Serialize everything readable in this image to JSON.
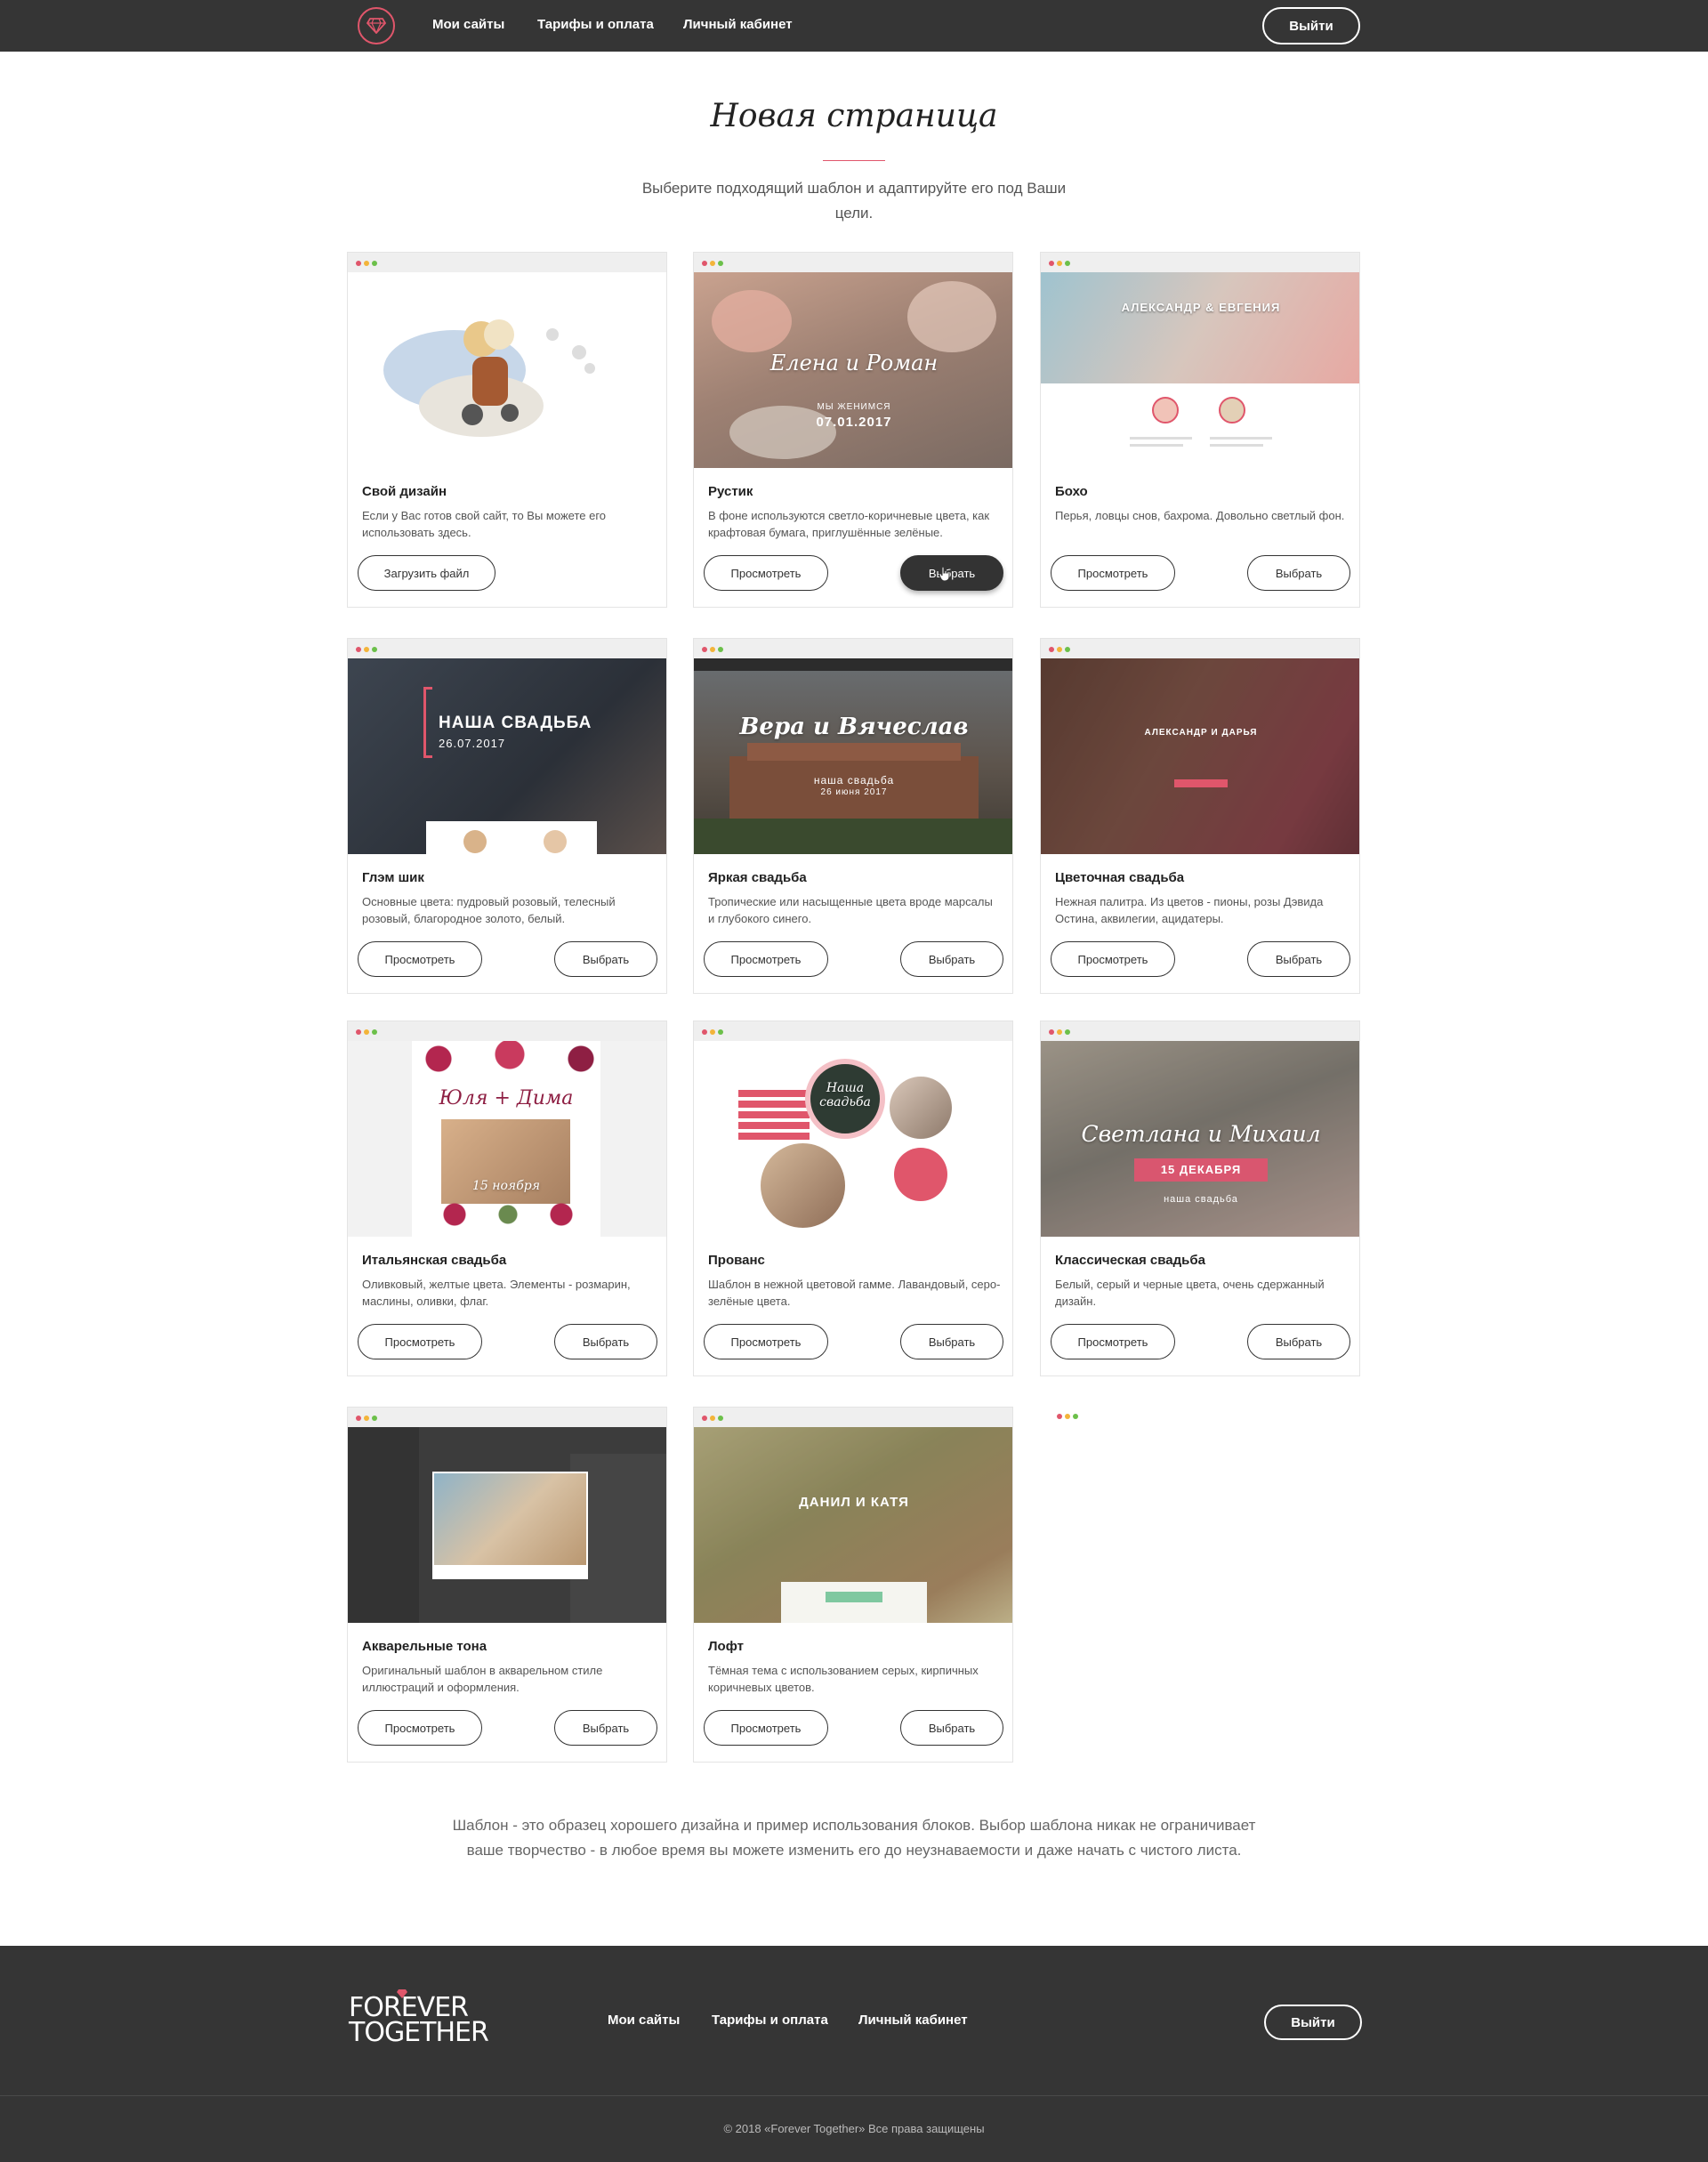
{
  "header": {
    "nav": [
      "Мои сайты",
      "Тарифы и оплата",
      "Личный кабинет"
    ],
    "logout": "Выйти"
  },
  "hero": {
    "title": "Новая страница",
    "subtitle": "Выберите подходящий шаблон и адаптируйте его под Ваши цели."
  },
  "cards": [
    {
      "title": "Свой дизайн",
      "desc": "Если у Вас готов свой сайт, то Вы можете его использовать здесь.",
      "primary": "Загрузить файл"
    },
    {
      "title": "Рустик",
      "desc": "В фоне используются светло-коричневые цвета, как крафтовая бумага, приглушённые зелёные.",
      "view": "Просмотреть",
      "pick": "Выбрать",
      "thumb_script": "Елена и Роман",
      "thumb_small": "МЫ ЖЕНИМСЯ",
      "thumb_date": "07.01.2017"
    },
    {
      "title": "Бохо",
      "desc": "Перья, ловцы снов, бахрома. Довольно светлый фон.",
      "view": "Просмотреть",
      "pick": "Выбрать",
      "thumb_caps": "АЛЕКСАНДР & ЕВГЕНИЯ"
    },
    {
      "title": "Глэм шик",
      "desc": "Основные цвета: пудровый розовый, телесный розовый, благородное золото, белый.",
      "view": "Просмотреть",
      "pick": "Выбрать",
      "thumb_caps": "НАША СВАДЬБА",
      "thumb_date": "26.07.2017"
    },
    {
      "title": "Яркая свадьба",
      "desc": "Тропические или насыщенные цвета вроде марсалы и глубокого синего.",
      "view": "Просмотреть",
      "pick": "Выбрать",
      "thumb_script": "Вера и Вячеслав",
      "thumb_small": "наша свадьба",
      "thumb_date": "26 июня 2017"
    },
    {
      "title": "Цветочная свадьба",
      "desc": "Нежная палитра. Из цветов - пионы, розы Дэвида Остина, аквилегии, ацидатеры.",
      "view": "Просмотреть",
      "pick": "Выбрать",
      "thumb_caps": "АЛЕКСАНДР И ДАРЬЯ"
    },
    {
      "title": "Итальянская свадьба",
      "desc": "Оливковый, желтые цвета. Элементы - розмарин, маслины, оливки, флаг.",
      "view": "Просмотреть",
      "pick": "Выбрать",
      "thumb_script": "Юля + Дима",
      "thumb_small": "15 ноября"
    },
    {
      "title": "Прованс",
      "desc": "Шаблон в нежной цветовой гамме. Лавандовый, серо-зелёные цвета.",
      "view": "Просмотреть",
      "pick": "Выбрать",
      "thumb_script": "Наша свадьба"
    },
    {
      "title": "Классическая свадьба",
      "desc": "Белый, серый и черные цвета, очень сдержанный дизайн.",
      "view": "Просмотреть",
      "pick": "Выбрать",
      "thumb_script": "Светлана и Михаил",
      "thumb_small": "15 ДЕКАБРЯ",
      "thumb_date": "наша свадьба"
    },
    {
      "title": "Акварельные тона",
      "desc": "Оригинальный шаблон в акварельном стиле иллюстраций и оформления.",
      "view": "Просмотреть",
      "pick": "Выбрать"
    },
    {
      "title": "Лофт",
      "desc": "Тёмная тема с использованием серых, кирпичных коричневых цветов.",
      "view": "Просмотреть",
      "pick": "Выбрать",
      "thumb_caps": "ДАНИЛ И КАТЯ"
    }
  ],
  "bottom_note": "Шаблон - это образец хорошего дизайна и пример использования блоков. Выбор шаблона никак не ограничивает ваше творчество - в любое время вы можете изменить его до неузнаваемости и даже начать с чистого листа.",
  "footer": {
    "logo_line1": "FOREVER",
    "logo_line2": "TOGETHER",
    "nav": [
      "Мои сайты",
      "Тарифы и оплата",
      "Личный кабинет"
    ],
    "logout": "Выйти",
    "copyright": "© 2018 «Forever Together» Все права защищены"
  },
  "colors": {
    "accent": "#e0566b",
    "dark": "#353535"
  }
}
